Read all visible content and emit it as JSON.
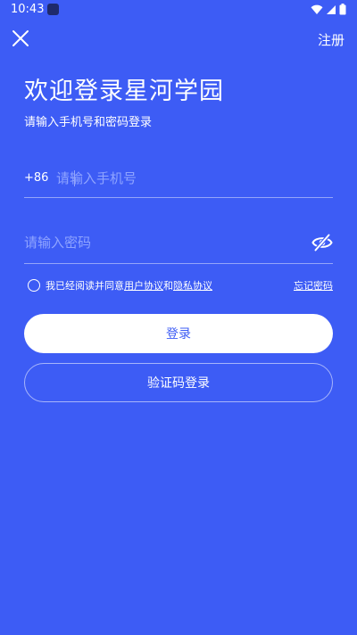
{
  "status_bar": {
    "time": "10:43",
    "icons": [
      "app-icon",
      "wifi-icon",
      "signal-icon",
      "battery-icon"
    ]
  },
  "header": {
    "close_icon": "close-icon",
    "register_label": "注册"
  },
  "title": "欢迎登录星河学园",
  "subtitle": "请输入手机号和密码登录",
  "phone": {
    "prefix": "+86",
    "value": "",
    "placeholder": "请输入手机号"
  },
  "password": {
    "value": "",
    "placeholder": "请输入密码",
    "toggle_icon": "eye-off-icon"
  },
  "agreement": {
    "prefix": "我已经阅读并同意",
    "user_agreement": "用户协议",
    "connector": "和",
    "privacy_agreement": "隐私协议",
    "checked": false
  },
  "forgot_label": "忘记密码",
  "login_label": "登录",
  "sms_login_label": "验证码登录",
  "colors": {
    "background": "#3d5cf5",
    "primary_text": "#ffffff",
    "placeholder": "#8fa4ff",
    "button_text": "#3d5cf5"
  }
}
